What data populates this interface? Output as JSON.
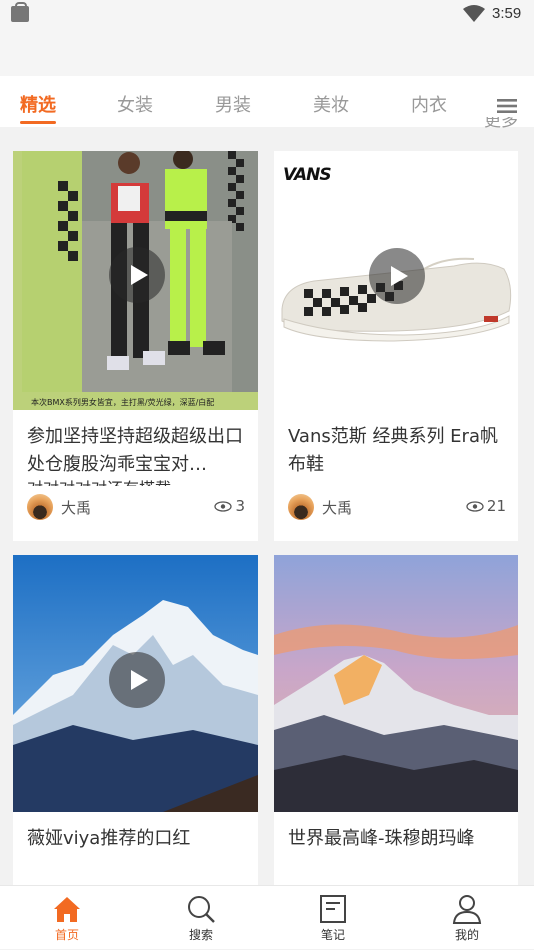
{
  "status_bar": {
    "time": "3:59"
  },
  "tabs": [
    {
      "label": "精选",
      "active": true
    },
    {
      "label": "女装",
      "active": false
    },
    {
      "label": "男装",
      "active": false
    },
    {
      "label": "美妆",
      "active": false
    },
    {
      "label": "内衣",
      "active": false
    }
  ],
  "more_label": "更多",
  "cards": [
    {
      "title": "参加坚持坚持超级超级出口处仓腹股沟乖宝宝对…",
      "title_overflow": "对对对对对还有搭载",
      "image_caption": "本次BMX系列男女皆宜，主打黑/荧光绿，深蓝/白配",
      "author": "大禹",
      "views": "3"
    },
    {
      "title": "Vans范斯 经典系列 Era帆布鞋",
      "brand_logo": "VANS",
      "author": "大禹",
      "views": "21"
    },
    {
      "title": "薇娅viya推荐的口红"
    },
    {
      "title": "世界最高峰-珠穆朗玛峰"
    }
  ],
  "bottom_nav": [
    {
      "label": "首页",
      "icon": "home-icon",
      "active": true
    },
    {
      "label": "搜索",
      "icon": "search-icon",
      "active": false
    },
    {
      "label": "笔记",
      "icon": "notes-icon",
      "active": false
    },
    {
      "label": "我的",
      "icon": "profile-icon",
      "active": false
    }
  ],
  "colors": {
    "accent": "#f26a22",
    "background": "#f2f2f2"
  }
}
